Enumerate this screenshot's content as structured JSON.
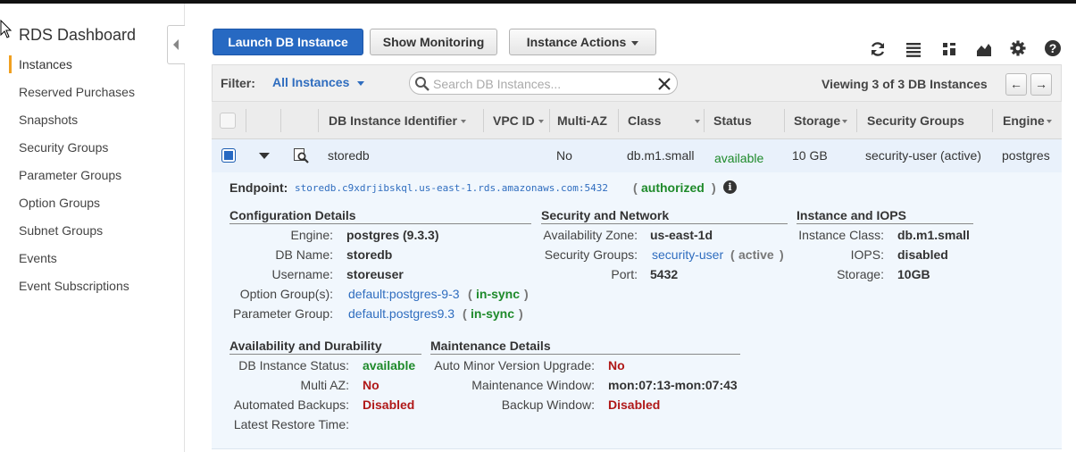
{
  "sidebar": {
    "title": "RDS Dashboard",
    "items": [
      {
        "label": "Instances",
        "active": true
      },
      {
        "label": "Reserved Purchases"
      },
      {
        "label": "Snapshots"
      },
      {
        "label": "Security Groups"
      },
      {
        "label": "Parameter Groups"
      },
      {
        "label": "Option Groups"
      },
      {
        "label": "Subnet Groups"
      },
      {
        "label": "Events"
      },
      {
        "label": "Event Subscriptions"
      }
    ]
  },
  "toolbar": {
    "launch_label": "Launch DB Instance",
    "monitoring_label": "Show Monitoring",
    "actions_label": "Instance Actions",
    "icons": [
      "refresh-icon",
      "list-view-icon",
      "grid-view-icon",
      "chart-icon",
      "gear-icon",
      "help-icon"
    ]
  },
  "filter": {
    "label": "Filter:",
    "value": "All Instances",
    "search_placeholder": "Search DB Instances...",
    "viewing": "Viewing 3 of 3 DB Instances",
    "prev": "←",
    "next": "→"
  },
  "table": {
    "columns": [
      "DB Instance Identifier",
      "VPC ID",
      "Multi-AZ",
      "Class",
      "Status",
      "Storage",
      "Security Groups",
      "Engine"
    ],
    "row": {
      "identifier": "storedb",
      "vpc_id": "",
      "multi_az": "No",
      "class": "db.m1.small",
      "status": "available",
      "storage": "10 GB",
      "security_groups": "security-user (active)",
      "engine": "postgres"
    }
  },
  "details": {
    "endpoint_label": "Endpoint:",
    "endpoint": "storedb.c9xdrjibskql.us-east-1.rds.amazonaws.com:5432",
    "endpoint_status": "authorized",
    "config": {
      "title": "Configuration Details",
      "engine_label": "Engine:",
      "engine": "postgres (9.3.3)",
      "dbname_label": "DB Name:",
      "dbname": "storedb",
      "username_label": "Username:",
      "username": "storeuser",
      "option_label": "Option Group(s):",
      "option": "default:postgres-9-3",
      "option_status": "in-sync",
      "param_label": "Parameter Group:",
      "param": "default.postgres9.3",
      "param_status": "in-sync"
    },
    "security": {
      "title": "Security and Network",
      "az_label": "Availability Zone:",
      "az": "us-east-1d",
      "sg_label": "Security Groups:",
      "sg": "security-user",
      "sg_status": "active",
      "port_label": "Port:",
      "port": "5432"
    },
    "iops": {
      "title": "Instance and IOPS",
      "class_label": "Instance Class:",
      "class": "db.m1.small",
      "iops_label": "IOPS:",
      "iops": "disabled",
      "storage_label": "Storage:",
      "storage": "10GB"
    },
    "availability": {
      "title": "Availability and Durability",
      "status_label": "DB Instance Status:",
      "status": "available",
      "multiaz_label": "Multi AZ:",
      "multiaz": "No",
      "backups_label": "Automated Backups:",
      "backups": "Disabled",
      "restore_label": "Latest Restore Time:"
    },
    "maintenance": {
      "title": "Maintenance Details",
      "minor_label": "Auto Minor Version Upgrade:",
      "minor": "No",
      "window_label": "Maintenance Window:",
      "window": "mon:07:13-mon:07:43",
      "backup_window_label": "Backup Window:",
      "backup_window": "Disabled"
    }
  }
}
